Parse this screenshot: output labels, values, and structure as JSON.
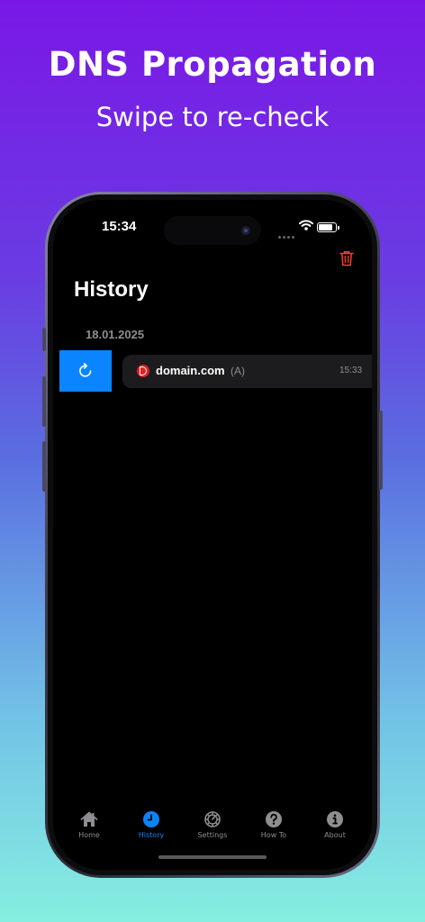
{
  "promo": {
    "headline": "DNS Propagation",
    "subline": "Swipe to re-check"
  },
  "status_bar": {
    "time": "15:34"
  },
  "header": {
    "title": "History",
    "delete_icon": "trash-icon"
  },
  "history": {
    "sections": [
      {
        "date": "18.01.2025",
        "items": [
          {
            "domain": "domain.com",
            "record_type": "(A)",
            "time": "15:33",
            "swipe_action_icon": "refresh-icon"
          }
        ]
      }
    ]
  },
  "tabs": [
    {
      "label": "Home",
      "icon": "house-icon",
      "active": false
    },
    {
      "label": "History",
      "icon": "clock-icon",
      "active": true
    },
    {
      "label": "Settings",
      "icon": "gear-icon",
      "active": false
    },
    {
      "label": "How To",
      "icon": "question-icon",
      "active": false
    },
    {
      "label": "About",
      "icon": "info-icon",
      "active": false
    }
  ],
  "colors": {
    "accent": "#0a84ff",
    "destructive": "#e02020",
    "background": "#000000",
    "row_background": "#1c1c1e"
  }
}
